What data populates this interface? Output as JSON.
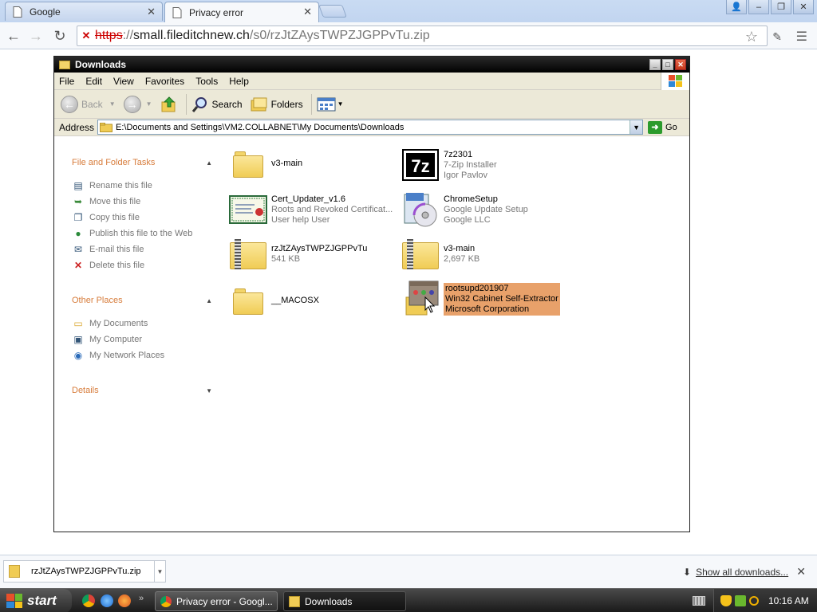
{
  "browser": {
    "tabs": [
      {
        "label": "Google",
        "icon": "document-icon"
      },
      {
        "label": "Privacy error",
        "icon": "document-icon"
      }
    ],
    "url": {
      "protocol": "https",
      "separator": "://",
      "host": "small.fileditchnew.ch",
      "path": "/s0/rzJtZAysTWPZJGPPvTu.zip"
    }
  },
  "explorer": {
    "title": "Downloads",
    "menu": [
      "File",
      "Edit",
      "View",
      "Favorites",
      "Tools",
      "Help"
    ],
    "toolbar": {
      "back": "Back",
      "search": "Search",
      "folders": "Folders"
    },
    "address_label": "Address",
    "address_value": "E:\\Documents and Settings\\VM2.COLLABNET\\My Documents\\Downloads",
    "go_label": "Go",
    "file_tasks": {
      "title": "File and Folder Tasks",
      "items": [
        "Rename this file",
        "Move this file",
        "Copy this file",
        "Publish this file to the Web",
        "E-mail this file",
        "Delete this file"
      ]
    },
    "other_places": {
      "title": "Other Places",
      "items": [
        "My Documents",
        "My Computer",
        "My Network Places"
      ]
    },
    "details": {
      "title": "Details"
    },
    "files": [
      {
        "name": "v3-main",
        "line2": "",
        "line3": "",
        "type": "folder"
      },
      {
        "name": "7z2301",
        "line2": "7-Zip Installer",
        "line3": "Igor Pavlov",
        "type": "7zip"
      },
      {
        "name": "Cert_Updater_v1.6",
        "line2": "Roots and Revoked Certificat...",
        "line3": "User help User",
        "type": "cert"
      },
      {
        "name": "ChromeSetup",
        "line2": "Google Update Setup",
        "line3": "Google LLC",
        "type": "setup"
      },
      {
        "name": "rzJtZAysTWPZJGPPvTu",
        "line2": "541 KB",
        "line3": "",
        "type": "zip"
      },
      {
        "name": "v3-main",
        "line2": "2,697 KB",
        "line3": "",
        "type": "zip"
      },
      {
        "name": "__MACOSX",
        "line2": "",
        "line3": "",
        "type": "folder"
      },
      {
        "name": "rootsupd201907",
        "line2": "Win32 Cabinet Self-Extractor",
        "line3": "Microsoft Corporation",
        "type": "cabinet"
      }
    ]
  },
  "download_shelf": {
    "item": "rzJtZAysTWPZJGPPvTu.zip",
    "show_all": "Show all downloads..."
  },
  "taskbar": {
    "start": "start",
    "buttons": [
      "Privacy error - Googl...",
      "Downloads"
    ],
    "clock": "10:16 AM"
  }
}
